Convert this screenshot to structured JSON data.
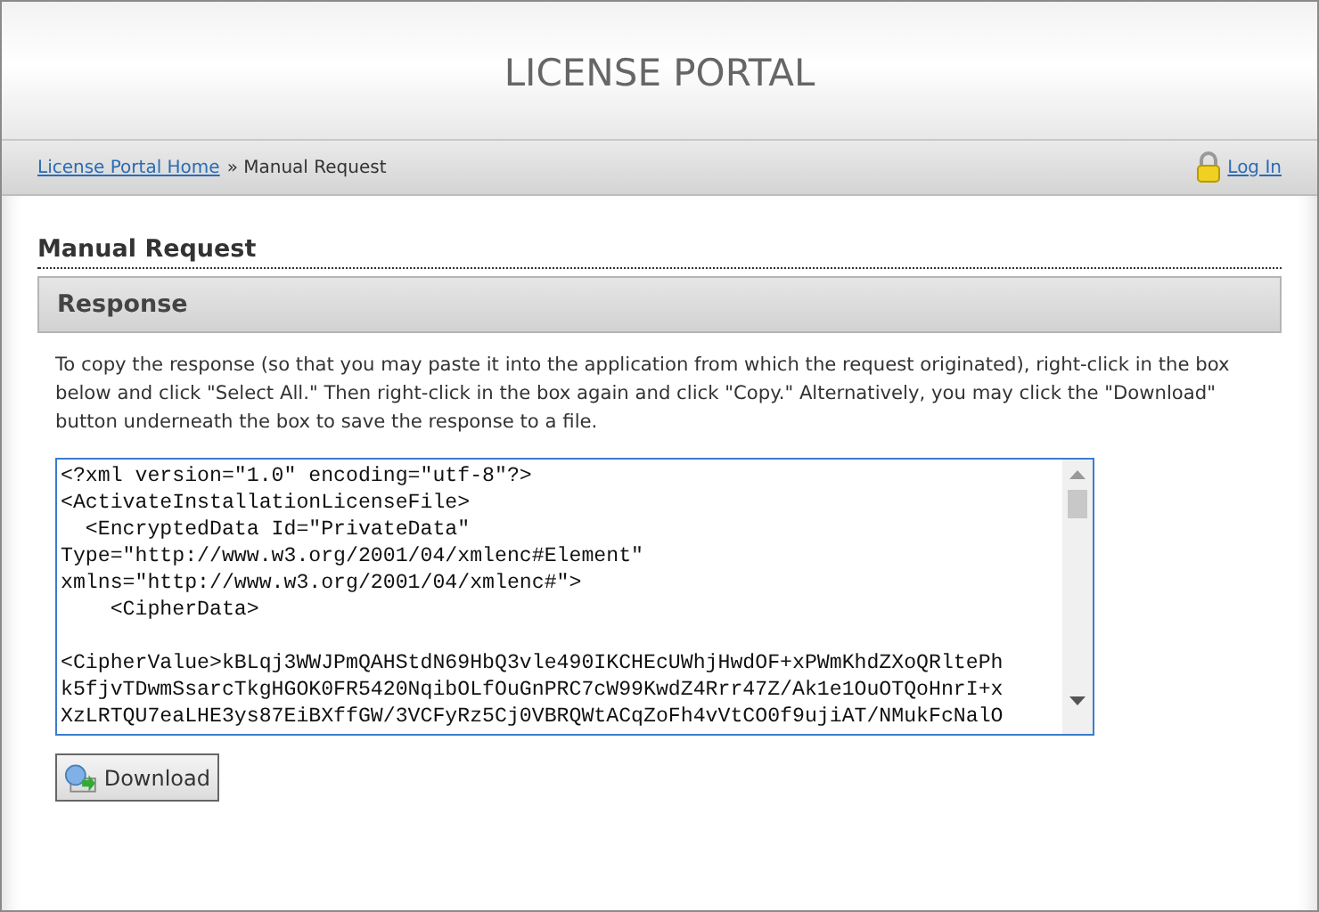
{
  "header": {
    "title": "LICENSE PORTAL"
  },
  "breadcrumb": {
    "home_link": "License Portal Home",
    "separator": "»",
    "current": "Manual Request",
    "login_link": "Log In"
  },
  "page_heading": "Manual Request",
  "section": {
    "title": "Response",
    "instructions": "To copy the response (so that you may paste it into the application from which the request originated), right-click in the box below and click \"Select All.\" Then right-click in the box again and click \"Copy.\" Alternatively, you may click the \"Download\" button underneath the box to save the response to a file.",
    "response_blocks": [
      [
        "<?xml version=\"1.0\" encoding=\"utf-8\"?>",
        "<ActivateInstallationLicenseFile>",
        "  <EncryptedData Id=\"PrivateData\"",
        "Type=\"http://www.w3.org/2001/04/xmlenc#Element\"",
        "xmlns=\"http://www.w3.org/2001/04/xmlenc#\">",
        "    <CipherData>"
      ],
      [
        "<CipherValue>kBLqj3WWJPmQAHStdN69HbQ3vle490IKCHEcUWhjHwdOF+xPWmKhdZXoQRltePh",
        "k5fjvTDwmSsarcTkgHGOK0FR5420NqibOLfOuGnPRC7cW99KwdZ4Rrr47Z/Ak1e1OuOTQoHnrI+x",
        "XzLRTQU7eaLHE3ys87EiBXffGW/3VCFyRz5Cj0VBRQWtACqZoFh4vVtCO0f9ujiAT/NMukFcNalO"
      ]
    ],
    "download_button": "Download"
  }
}
